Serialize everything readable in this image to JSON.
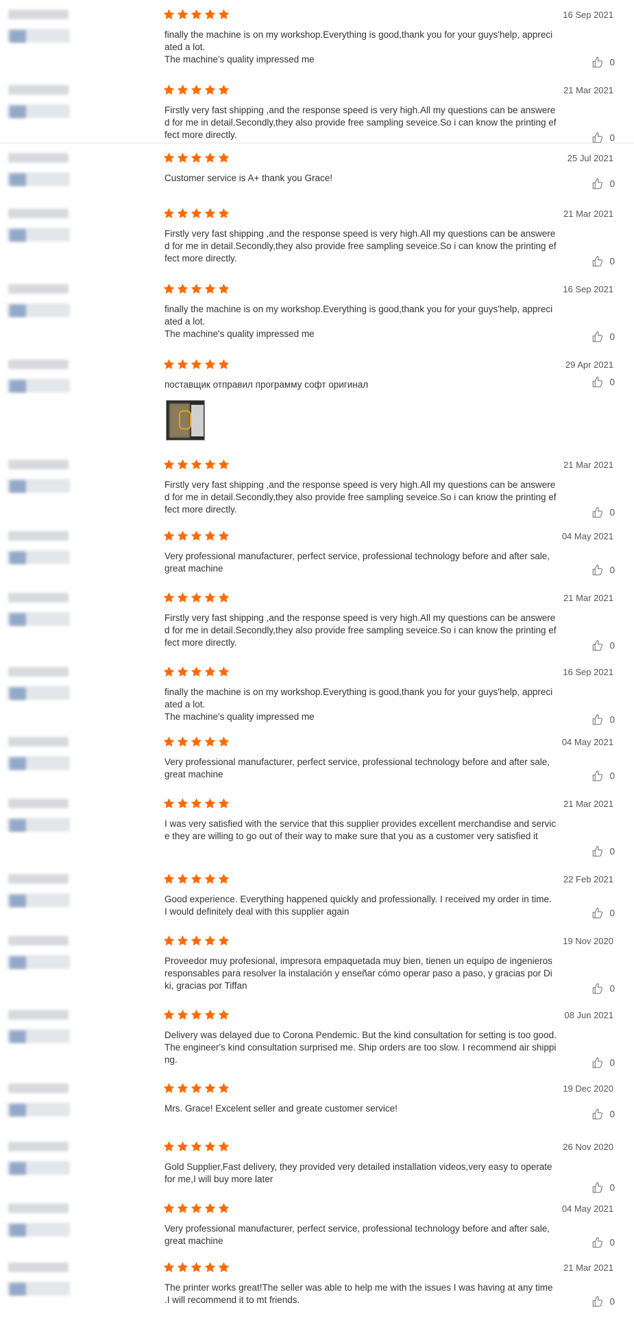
{
  "colors": {
    "star": "#ff6a00",
    "text": "#333333",
    "date": "#555555"
  },
  "reviews": [
    {
      "date": "16 Sep 2021",
      "text": "finally the machine is on my workshop.Everything is good,thank you for your guys'help, appreciated a lot.\nThe machine's quality impressed me",
      "likes": "0"
    },
    {
      "date": "21 Mar 2021",
      "text": "Firstly very fast shipping ,and the response speed is very high.All my questions can be answered for me in detail.Secondly,they also provide free sampling seveice.So i can know the printing effect more directly.",
      "likes": "0"
    },
    {
      "date": "25 Jul 2021",
      "text": "Customer service is A+ thank you Grace!",
      "likes": "0"
    },
    {
      "date": "21 Mar 2021",
      "text": "Firstly very fast shipping ,and the response speed is very high.All my questions can be answered for me in detail.Secondly,they also provide free sampling seveice.So i can know the printing effect more directly.",
      "likes": "0"
    },
    {
      "date": "16 Sep 2021",
      "text": "finally the machine is on my workshop.Everything is good,thank you for your guys'help, appreciated a lot.\nThe machine's quality impressed me",
      "likes": "0"
    },
    {
      "date": "29 Apr 2021",
      "text": "поставщик отправил программу софт оригинал",
      "likes": "0"
    },
    {
      "date": "21 Mar 2021",
      "text": "Firstly very fast shipping ,and the response speed is very high.All my questions can be answered for me in detail.Secondly,they also provide free sampling seveice.So i can know the printing effect more directly.",
      "likes": "0"
    },
    {
      "date": "04 May 2021",
      "text": "Very professional manufacturer, perfect service, professional technology before and after sale, great machine",
      "likes": "0"
    },
    {
      "date": "21 Mar 2021",
      "text": "Firstly very fast shipping ,and the response speed is very high.All my questions can be answered for me in detail.Secondly,they also provide free sampling seveice.So i can know the printing effect more directly.",
      "likes": "0"
    },
    {
      "date": "16 Sep 2021",
      "text": "finally the machine is on my workshop.Everything is good,thank you for your guys'help, appreciated a lot.\nThe machine's quality impressed me",
      "likes": "0"
    },
    {
      "date": "04 May 2021",
      "text": "Very professional manufacturer, perfect service, professional technology before and after sale, great machine",
      "likes": "0"
    },
    {
      "date": "21 Mar 2021",
      "text": "I was very satisfied with the service that this supplier provides excellent merchandise and service they are willing to go out of their way to make sure that you as a customer very satisfied it",
      "likes": "0"
    },
    {
      "date": "22 Feb 2021",
      "text": "Good experience. Everything happened quickly and professionally. I received my order in time. I would definitely deal with this supplier again",
      "likes": "0"
    },
    {
      "date": "19 Nov 2020",
      "text": "Proveedor muy profesional, impresora empaquetada muy bien, tienen un equipo de ingenieros responsables para resolver la instalación y enseñar cómo operar paso a paso, y gracias por Diki, gracias por Tiffan",
      "likes": "0"
    },
    {
      "date": "08 Jun 2021",
      "text": "Delivery was delayed due to Corona Pendemic. But the kind consultation for setting is too good. The engineer's kind consultation surprised me. Ship orders are too slow. I recommend air shipping.",
      "likes": "0"
    },
    {
      "date": "19 Dec 2020",
      "text": "Mrs. Grace! Excelent seller and greate customer service!",
      "likes": "0"
    },
    {
      "date": "26 Nov 2020",
      "text": "Gold Supplier,Fast delivery, they provided very detailed installation videos,very easy to operate for me,I will buy more later",
      "likes": "0"
    },
    {
      "date": "04 May 2021",
      "text": "Very professional manufacturer, perfect service, professional technology before and after sale, great machine",
      "likes": "0"
    },
    {
      "date": "21 Mar 2021",
      "text": "The printer works great!The seller was able to help me with the issues I was having at any time .I will recommend it to mt friends.",
      "likes": "0"
    }
  ]
}
